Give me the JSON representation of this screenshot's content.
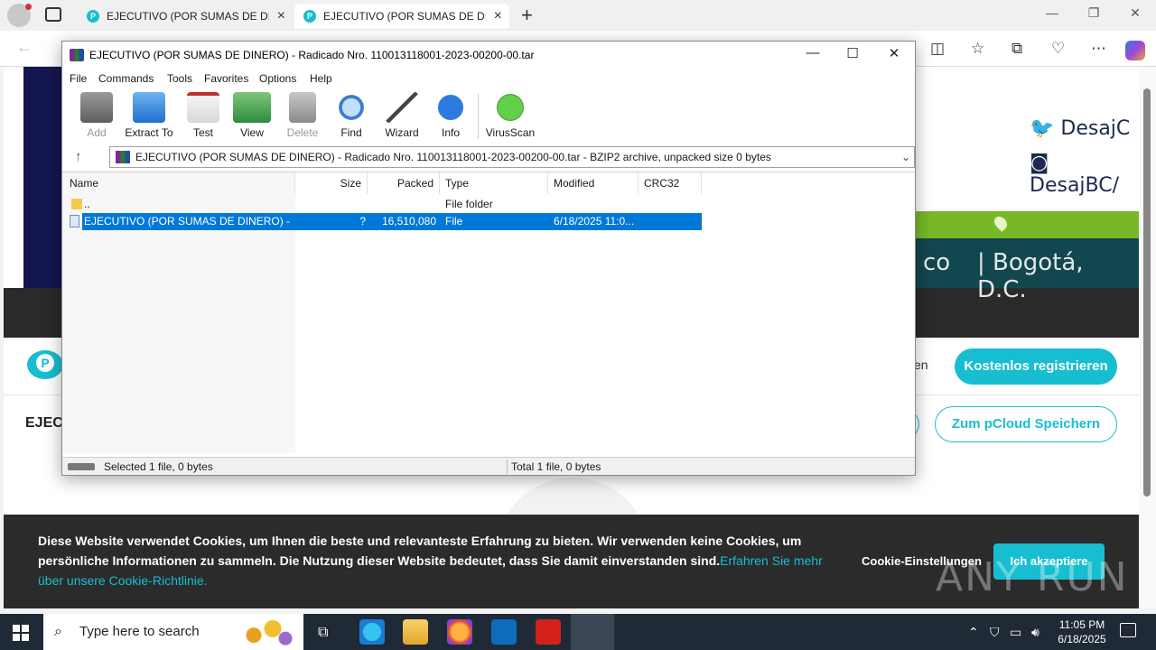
{
  "browser": {
    "tabs": [
      {
        "title": "EJECUTIVO (POR SUMAS DE DINERO)"
      },
      {
        "title": "EJECUTIVO (POR SUMAS DE DINERO)"
      }
    ]
  },
  "webpage": {
    "social_twitter": "DesajC",
    "social_instagram": "DesajBC/",
    "banner_left_text": "co",
    "banner_city": "| Bogotá, D.C.",
    "login_fragment": "en",
    "register_button": "Kostenlos registrieren",
    "file_title_fragment": "EJEC",
    "save_button": "Zum pCloud Speichern",
    "cookie": {
      "message": "Diese Website verwendet Cookies, um Ihnen die beste und relevanteste Erfahrung zu bieten. Wir verwenden keine Cookies, um persönliche Informationen zu sammeln. Die Nutzung dieser Website bedeutet, dass Sie damit einverstanden sind.",
      "link": "Erfahren Sie mehr über unsere Cookie-Richtlinie.",
      "settings": "Cookie-Einstellungen",
      "accept": "Ich akzeptiere"
    },
    "watermark": "ANY RUN"
  },
  "winrar": {
    "title": "EJECUTIVO (POR SUMAS DE DINERO) - Radicado Nro. 110013118001-2023-00200-00.tar",
    "menu": [
      "File",
      "Commands",
      "Tools",
      "Favorites",
      "Options",
      "Help"
    ],
    "toolbar": [
      {
        "label": "Add",
        "enabled": false
      },
      {
        "label": "Extract To",
        "enabled": true
      },
      {
        "label": "Test",
        "enabled": true
      },
      {
        "label": "View",
        "enabled": true
      },
      {
        "label": "Delete",
        "enabled": false
      },
      {
        "label": "Find",
        "enabled": true
      },
      {
        "label": "Wizard",
        "enabled": true
      },
      {
        "label": "Info",
        "enabled": true
      },
      {
        "label": "VirusScan",
        "enabled": true
      }
    ],
    "path": "EJECUTIVO (POR SUMAS DE DINERO) - Radicado Nro. 110013118001-2023-00200-00.tar - BZIP2 archive, unpacked size 0 bytes",
    "columns": [
      "Name",
      "Size",
      "Packed",
      "Type",
      "Modified",
      "CRC32"
    ],
    "rows": [
      {
        "name": "..",
        "size": "",
        "packed": "",
        "type": "File folder",
        "modified": "",
        "crc": ""
      },
      {
        "name": "EJECUTIVO (POR SUMAS DE DINERO) - Ra...",
        "size": "?",
        "packed": "16,510,080",
        "type": "File",
        "modified": "6/18/2025 11:0...",
        "crc": ""
      }
    ],
    "status_left": "Selected 1 file, 0 bytes",
    "status_right": "Total 1 file, 0 bytes"
  },
  "taskbar": {
    "search_placeholder": "Type here to search",
    "time": "11:05 PM",
    "date": "6/18/2025"
  }
}
